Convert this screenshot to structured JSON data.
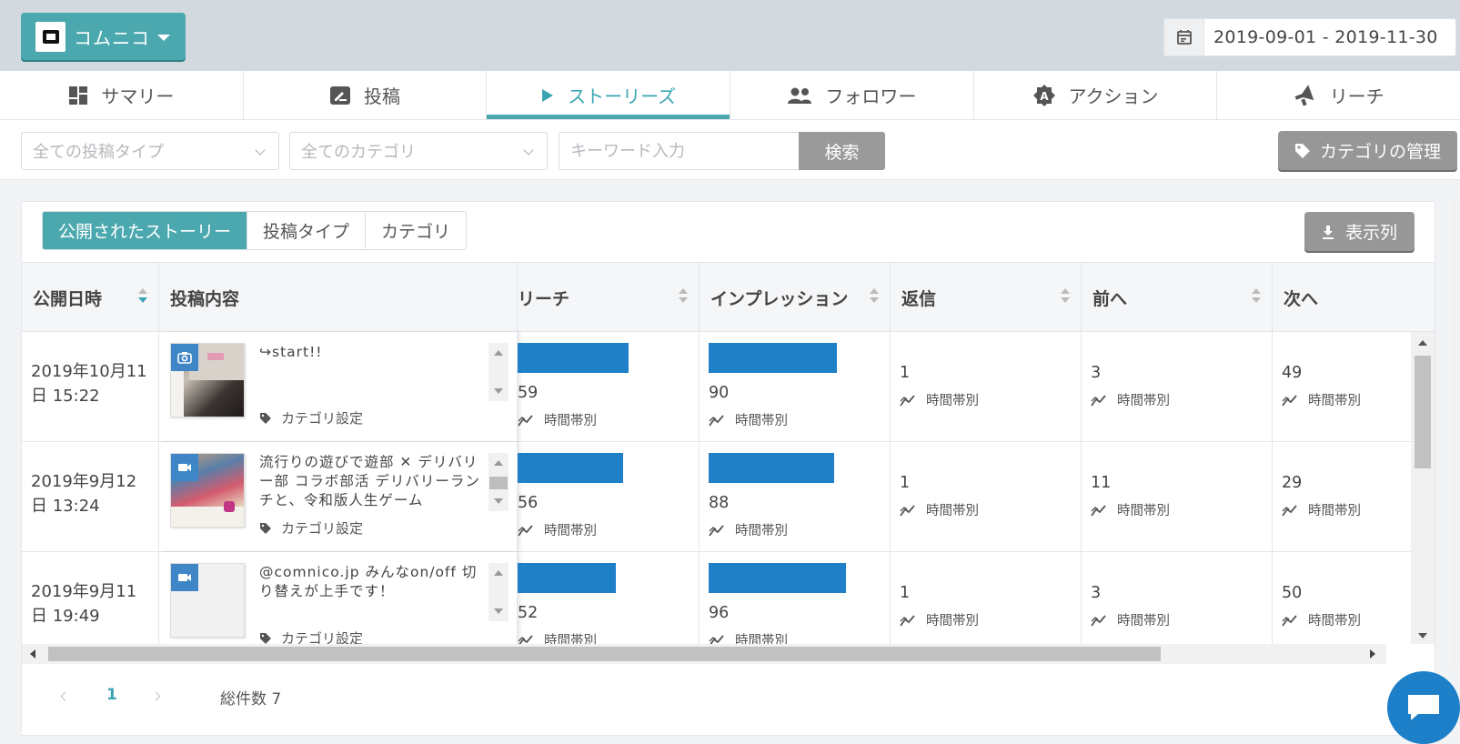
{
  "account": {
    "name": "コムニコ"
  },
  "daterange": {
    "text": "2019-09-01  -  2019-11-30"
  },
  "tabs": [
    {
      "label": "サマリー",
      "icon": "dashboard-icon"
    },
    {
      "label": "投稿",
      "icon": "post-edit-icon"
    },
    {
      "label": "ストーリーズ",
      "icon": "play-icon"
    },
    {
      "label": "フォロワー",
      "icon": "people-icon"
    },
    {
      "label": "アクション",
      "icon": "action-badge-icon"
    },
    {
      "label": "リーチ",
      "icon": "megaphone-icon"
    }
  ],
  "filters": {
    "post_type": "全ての投稿タイプ",
    "category": "全てのカテゴリ",
    "keyword_placeholder": "キーワード入力",
    "search_label": "検索",
    "category_manage_label": "カテゴリの管理"
  },
  "panel": {
    "segments": [
      "公開されたストーリー",
      "投稿タイプ",
      "カテゴリ"
    ],
    "columns_label": "表示列"
  },
  "table": {
    "headers": {
      "date": "公開日時",
      "content": "投稿内容",
      "reach": "リーチ",
      "impressions": "インプレッション",
      "replies": "返信",
      "prev": "前へ",
      "next": "次へ"
    },
    "category_setting_label": "カテゴリ設定",
    "hourly_label": "時間帯別",
    "rows": [
      {
        "date": "2019年10月11日 15:22",
        "media": "photo",
        "text": "↪start!!",
        "reach": "59",
        "impressions": "90",
        "replies": "1",
        "prev": "3",
        "next": "49"
      },
      {
        "date": "2019年9月12日 13:24",
        "media": "video",
        "text": "流行りの遊びで遊部 ✕ デリバリー部 コラボ部活 デリバリーランチと、令和版人生ゲーム",
        "reach": "56",
        "impressions": "88",
        "replies": "1",
        "prev": "11",
        "next": "29"
      },
      {
        "date": "2019年9月11日 19:49",
        "media": "video",
        "text": "@comnico.jp みんなon/off 切り替えが上手です！",
        "reach": "52",
        "impressions": "96",
        "replies": "1",
        "prev": "3",
        "next": "50"
      }
    ]
  },
  "pager": {
    "page": "1",
    "total": "総件数 7"
  },
  "colors": {
    "accent": "#4aa8ae",
    "bar": "#1f7fc7",
    "button_gray": "#979797"
  }
}
